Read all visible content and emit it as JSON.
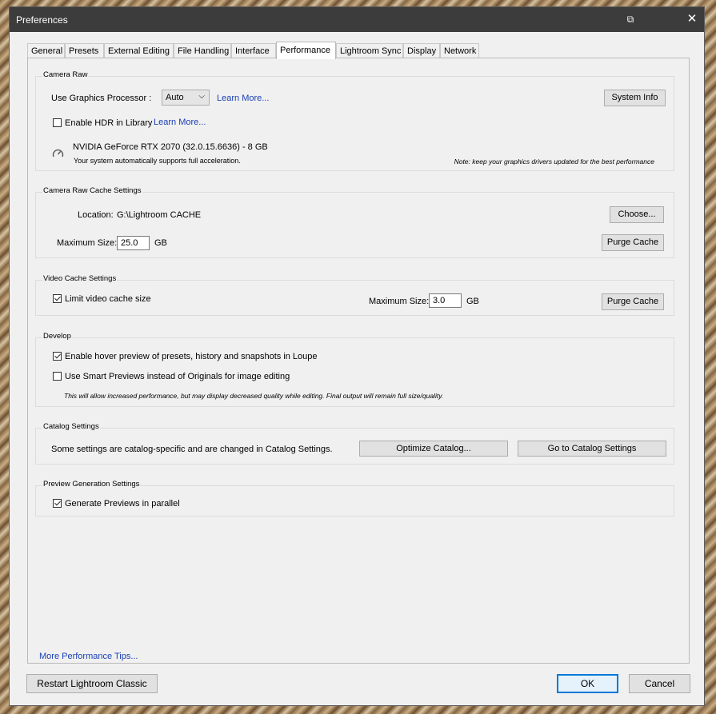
{
  "window": {
    "title": "Preferences"
  },
  "tabs": [
    "General",
    "Presets",
    "External Editing",
    "File Handling",
    "Interface",
    "Performance",
    "Lightroom Sync",
    "Display",
    "Network"
  ],
  "camera_raw": {
    "title": "Camera Raw",
    "gpu_label": "Use Graphics Processor :",
    "gpu_value": "Auto",
    "learn_more_1": "Learn More...",
    "system_info": "System Info",
    "hdr_label": "Enable HDR in Library",
    "learn_more_2": "Learn More...",
    "gpu_name": "NVIDIA GeForce RTX 2070 (32.0.15.6636) - 8 GB",
    "gpu_status": "Your system automatically supports full acceleration.",
    "gpu_note": "Note: keep your graphics drivers updated for the best performance"
  },
  "cache": {
    "title": "Camera Raw Cache Settings",
    "location_label": "Location:",
    "location_value": "G:\\Lightroom CACHE",
    "choose": "Choose...",
    "max_label": "Maximum Size:",
    "max_value": "25.0",
    "unit": "GB",
    "purge": "Purge Cache"
  },
  "video": {
    "title": "Video Cache Settings",
    "limit_label": "Limit video cache size",
    "max_label": "Maximum Size:",
    "max_value": "3.0",
    "unit": "GB",
    "purge": "Purge Cache"
  },
  "develop": {
    "title": "Develop",
    "hover_label": "Enable hover preview of presets, history and snapshots in Loupe",
    "smart_label": "Use Smart Previews instead of Originals for image editing",
    "note": "This will allow increased performance, but may display decreased quality while editing. Final output will remain full size/quality."
  },
  "catalog": {
    "title": "Catalog Settings",
    "text": "Some settings are catalog-specific and are changed in Catalog Settings.",
    "optimize": "Optimize Catalog...",
    "goto": "Go to Catalog Settings"
  },
  "preview": {
    "title": "Preview Generation Settings",
    "parallel_label": "Generate Previews in parallel"
  },
  "footer": {
    "tips": "More Performance Tips...",
    "restart": "Restart Lightroom Classic",
    "ok": "OK",
    "cancel": "Cancel"
  }
}
